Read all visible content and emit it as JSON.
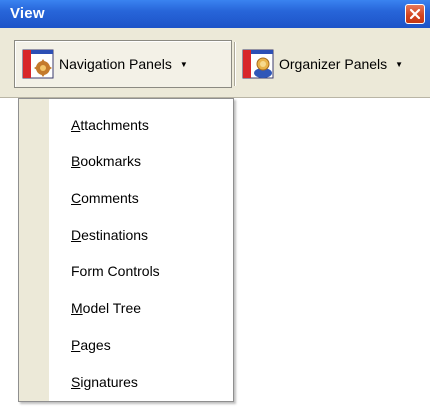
{
  "window": {
    "title": "View"
  },
  "toolbar": {
    "navigation_panels": {
      "label": "Navigation Panels",
      "arrow": "▼"
    },
    "organizer_panels": {
      "label": "Organizer Panels",
      "arrow": "▼"
    }
  },
  "menu": {
    "items": [
      {
        "label": "Attachments",
        "mnemonic": "A",
        "rest": "ttachments"
      },
      {
        "label": "Bookmarks",
        "mnemonic": "B",
        "rest": "ookmarks"
      },
      {
        "label": "Comments",
        "mnemonic": "C",
        "rest": "omments"
      },
      {
        "label": "Destinations",
        "mnemonic": "D",
        "rest": "estinations"
      },
      {
        "label": "Form Controls",
        "mnemonic": "",
        "rest": "Form Controls"
      },
      {
        "label": "Model Tree",
        "mnemonic": "M",
        "rest": "odel Tree"
      },
      {
        "label": "Pages",
        "mnemonic": "P",
        "rest": "ages"
      },
      {
        "label": "Signatures",
        "mnemonic": "S",
        "rest": "ignatures"
      }
    ]
  },
  "colors": {
    "titlebar": "#2765d9",
    "toolbar_bg": "#ece9d8",
    "close_button": "#d2431d"
  }
}
